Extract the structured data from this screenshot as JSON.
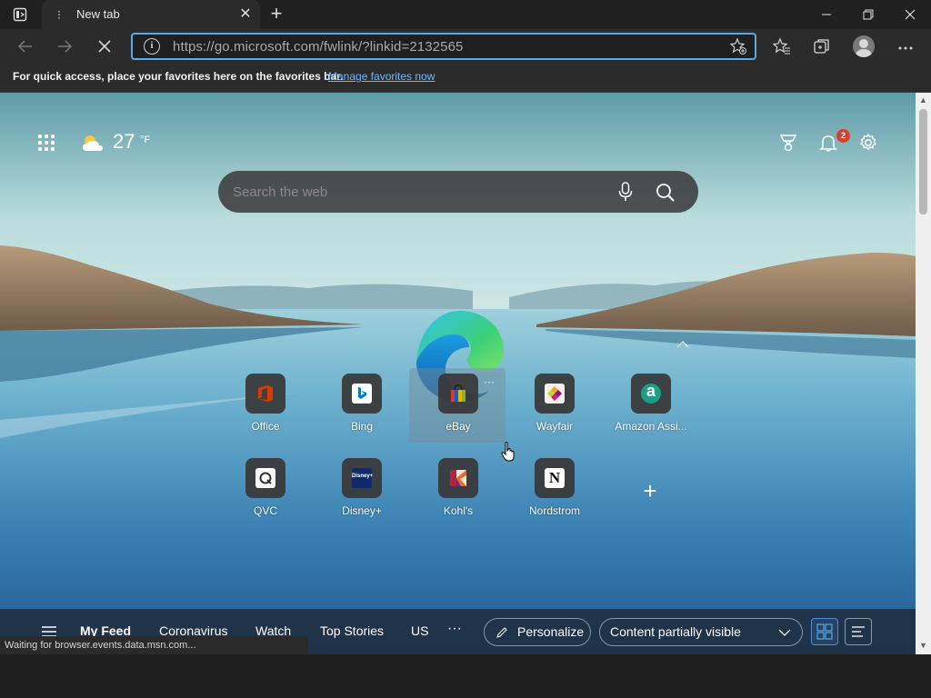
{
  "tab": {
    "title": "New tab",
    "close_glyph": "✕"
  },
  "toolbar": {
    "url_host": "https://go.microsoft.com",
    "url_path": "/fwlink/?linkid=2132565"
  },
  "favorites_bar": {
    "message": "For quick access, place your favorites here on the favorites bar.",
    "link": "Manage favorites now"
  },
  "weather": {
    "temperature": "27",
    "unit": "°F"
  },
  "notifications": {
    "count": "2"
  },
  "search": {
    "placeholder": "Search the web"
  },
  "quick_links": [
    {
      "label": "Office",
      "icon": "office-icon",
      "color": "#d83b01"
    },
    {
      "label": "Bing",
      "icon": "bing-icon",
      "color": "#0078d4"
    },
    {
      "label": "eBay",
      "icon": "ebay-icon",
      "color": "#e53238"
    },
    {
      "label": "Wayfair",
      "icon": "wayfair-icon",
      "color": "#7f187f"
    },
    {
      "label": "Amazon Assi...",
      "icon": "amazon-assistant-icon",
      "color": "#1a9e86"
    },
    {
      "label": "QVC",
      "icon": "qvc-icon",
      "color": "#ffffff"
    },
    {
      "label": "Disney+",
      "icon": "disney-plus-icon",
      "color": "#0f2a6b"
    },
    {
      "label": "Kohl's",
      "icon": "kohls-icon",
      "color": "#b8203c"
    },
    {
      "label": "Nordstrom",
      "icon": "nordstrom-icon",
      "color": "#ffffff"
    }
  ],
  "feed": {
    "menu_icon": "hamburger-icon",
    "tabs": [
      "My Feed",
      "Coronavirus",
      "Watch",
      "Top Stories",
      "US"
    ],
    "more": "···",
    "personalize": "Personalize",
    "content_visibility": "Content partially visible"
  },
  "status": {
    "text": "Waiting for browser.events.data.msn.com..."
  },
  "colors": {
    "accent": "#5aa8e6",
    "link": "#6cb8ff",
    "badge": "#d4412f"
  }
}
